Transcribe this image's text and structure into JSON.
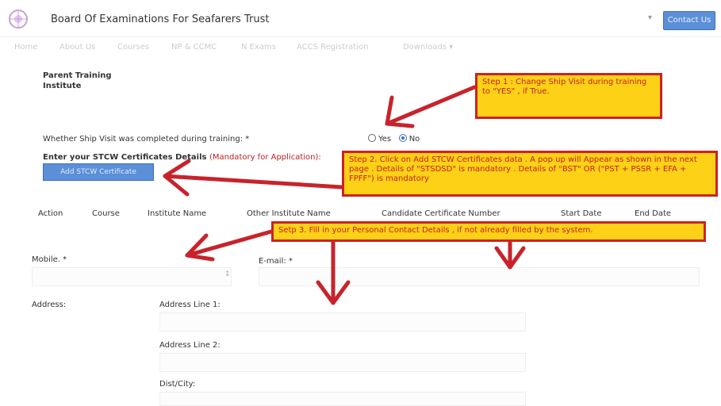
{
  "header": {
    "title": "Board Of Examinations For Seafarers Trust",
    "contact_label": "Contact Us",
    "logo_icon": "trust-logo-icon"
  },
  "nav": [
    "Home",
    "About Us",
    "Courses",
    "NP & CCMC",
    "N Exams",
    "ACCS Registration",
    "Downloads ▾"
  ],
  "form": {
    "parent_institute_label_1": "Parent Training",
    "parent_institute_label_2": "Institute",
    "ship_visit_label": "Whether Ship Visit was completed during training: *",
    "yes_label": "Yes",
    "no_label": "No",
    "ship_visit_value": "No",
    "stcw_label": "Enter your STCW Certificates Details",
    "stcw_mandatory": "(Mandatory for Application):",
    "add_button": "Add STCW Certificate",
    "mobile_label": "Mobile. *",
    "email_label": "E-mail: *",
    "address_label": "Address:",
    "address1_label": "Address Line 1:",
    "address2_label": "Address Line 2:",
    "city_label": "Dist/City:"
  },
  "table": {
    "headers": [
      "Action",
      "Course",
      "Institute Name",
      "Other Institute Name",
      "Candidate Certificate Number",
      "Start Date",
      "End Date"
    ]
  },
  "callouts": {
    "step1": "Step 1 : Change Ship Visit during training to \"YES\" , if True.",
    "step2": "Step 2. Click on Add STCW Certificates data . A pop up will Appear as shown in the next page . Details of \"STSDSD\" is mandatory . Details of \"BST\" OR (\"PST + PSSR + EFA + FPFF\") is mandatory",
    "step3": "Setp 3. Fill in your Personal Contact Details , if not already filled by the system."
  },
  "colors": {
    "callout_bg": "#fcd116",
    "callout_border": "#cc2222",
    "arrow": "#c8232c",
    "button": "#5b8fd8"
  }
}
